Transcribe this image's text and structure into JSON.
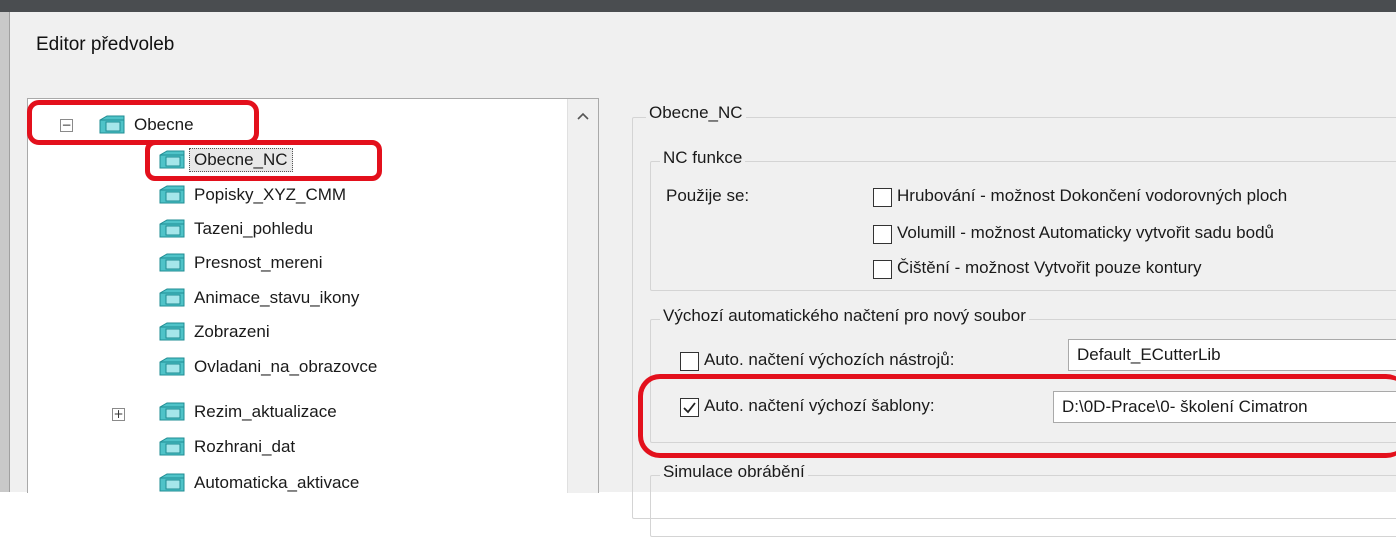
{
  "window": {
    "title": "Editor předvoleb"
  },
  "tree": {
    "items": [
      {
        "label": "Obecne",
        "expander": "−"
      },
      {
        "label": "Obecne_NC"
      },
      {
        "label": "Popisky_XYZ_CMM"
      },
      {
        "label": "Tazeni_pohledu"
      },
      {
        "label": "Presnost_mereni"
      },
      {
        "label": "Animace_stavu_ikony"
      },
      {
        "label": "Zobrazeni"
      },
      {
        "label": "Ovladani_na_obrazovce"
      },
      {
        "label": "Rezim_aktualizace",
        "expander": "+"
      },
      {
        "label": "Rozhrani_dat"
      },
      {
        "label": "Automaticka_aktivace"
      }
    ],
    "selected": "Obecne_NC"
  },
  "panel": {
    "title": "Obecne_NC",
    "nc_funkce": {
      "label": "NC funkce",
      "pouzije_se": "Použije se:",
      "options": [
        {
          "label": "Hrubování - možnost Dokončení vodorovných ploch",
          "checked": false
        },
        {
          "label": "Volumill - možnost Automaticky vytvořit sadu bodů",
          "checked": false
        },
        {
          "label": "Čištění - možnost Vytvořit pouze kontury",
          "checked": false
        }
      ]
    },
    "auto_load": {
      "label": "Výchozí automatického načtení pro nový soubor",
      "tools": {
        "label": "Auto. načtení výchozích nástrojů:",
        "checked": false,
        "value": "Default_ECutterLib"
      },
      "template": {
        "label": "Auto. načtení výchozí šablony:",
        "checked": true,
        "value": "D:\\0D-Prace\\0- školení Cimatron"
      }
    },
    "simulace": {
      "label": "Simulace obrábění"
    }
  },
  "colors": {
    "highlight": "#e3101c",
    "window_bg": "#f0f0f0",
    "titlebar": "#4a4d50"
  }
}
